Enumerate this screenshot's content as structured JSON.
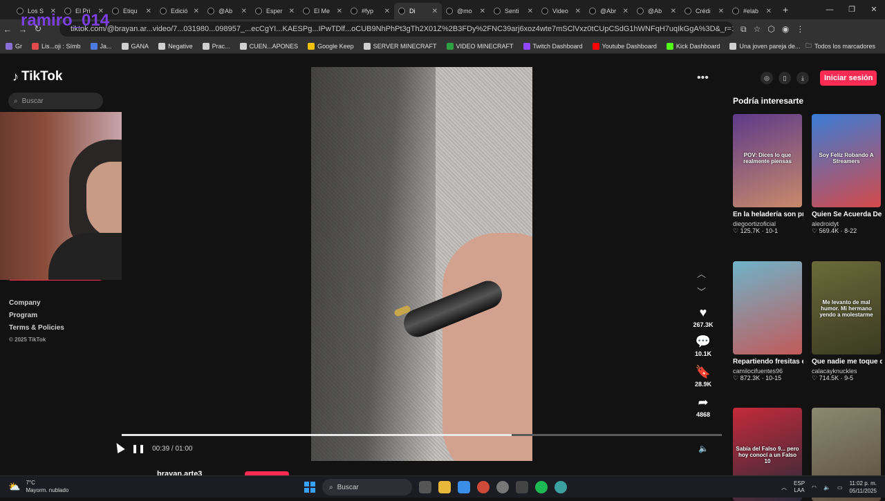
{
  "browser": {
    "tabs": [
      {
        "label": "Los S"
      },
      {
        "label": "El Pri"
      },
      {
        "label": "Etiqu"
      },
      {
        "label": "Edició"
      },
      {
        "label": "@Ab"
      },
      {
        "label": "Esper"
      },
      {
        "label": "El Me"
      },
      {
        "label": "#fyp"
      },
      {
        "label": "Di"
      },
      {
        "label": "@mo"
      },
      {
        "label": "Senti"
      },
      {
        "label": "Video"
      },
      {
        "label": "@Abr"
      },
      {
        "label": "@Ab"
      },
      {
        "label": "Crédi"
      },
      {
        "label": "#elab"
      }
    ],
    "new_tab": "+",
    "url": "tiktok.com/@brayan.ar...video/7...031980...098957_...ecCgYI...KAESPg...IPwTDlf...oCUB9NhPhPt3gTh2X01Z%2B3FDy%2FNC39arj6xoz4wte7mSClVxz0tCUpCSdG1hWNFqH7uqIkGgA%3D&_r=1&_svg=1&check...",
    "bookmarks": [
      {
        "label": "Gr",
        "color": "#8a6fd6"
      },
      {
        "label": "Lis...oji : Símb",
        "color": "#e04a4a"
      },
      {
        "label": "Ja...",
        "color": "#4a7be0"
      },
      {
        "label": "GANA",
        "color": "#d0d0d0"
      },
      {
        "label": "Negative",
        "color": "#d0d0d0"
      },
      {
        "label": "Prac...",
        "color": "#d0d0d0"
      },
      {
        "label": "CUEN...APONES",
        "color": "#d0d0d0"
      },
      {
        "label": "Google Keep",
        "color": "#f4c20d"
      },
      {
        "label": "SERVER MINECRAFT",
        "color": "#d0d0d0"
      },
      {
        "label": "VIDEO MINECRAFT",
        "color": "#2ea043"
      },
      {
        "label": "Twitch Dashboard",
        "color": "#9146ff"
      },
      {
        "label": "Youtube Dashboard",
        "color": "#ff0000"
      },
      {
        "label": "Kick Dashboard",
        "color": "#53fc18"
      },
      {
        "label": "Una joven pareja de...",
        "color": "#d0d0d0"
      }
    ],
    "all_bookmarks": "Todos los marcadores"
  },
  "overlay": {
    "streamer_name": "ramiro_014"
  },
  "sidebar": {
    "logo": "TikTok",
    "search_placeholder": "Buscar",
    "links": [
      "Company",
      "Program",
      "Terms & Policies"
    ],
    "copyright": "© 2025 TikTok"
  },
  "video": {
    "likes": "267.3K",
    "comments": "10.1K",
    "saves": "28.9K",
    "shares": "4868",
    "time": "00:39 / 01:00",
    "progress": 0.65,
    "author": "brayan.arte3"
  },
  "header": {
    "login_label": "Iniciar sesión"
  },
  "suggestions": {
    "title": "Podría interesarte",
    "items": [
      {
        "title": "En la heladería son primero los modale...",
        "author": "diegoortizoficial",
        "likes": "125.7K",
        "date": "10-1",
        "thumb_text": "POV: Dices lo que realmente piensas",
        "thumb_colors": [
          "#5e3a8a",
          "#c98a6a"
        ]
      },
      {
        "title": "Quien Se Acuerda De Esto? 😍 💜 #Roblo...",
        "author": "aledroidyt",
        "likes": "569.4K",
        "date": "8-22",
        "thumb_text": "Soy Feliz Robando A Streamers",
        "thumb_colors": [
          "#3a7bd5",
          "#d44a4a"
        ]
      },
      {
        "title": "Repartiendo fresitas en la calle 🍓 📍 ...",
        "author": "camilocifuentes96",
        "likes": "872.3K",
        "date": "10-15",
        "thumb_text": "",
        "thumb_colors": [
          "#6fb3c9",
          "#c25a5a"
        ]
      },
      {
        "title": "Que nadie me toque que estoy de malas...",
        "author": "calacayknuckles",
        "likes": "714.5K",
        "date": "9-5",
        "thumb_text": "Me levanto de mal humor. Mi hermano yendo a molestarme",
        "thumb_colors": [
          "#6b6b3a",
          "#3a3a22"
        ]
      },
      {
        "title": "",
        "author": "",
        "likes": "",
        "date": "",
        "thumb_text": "Sabía del Falso 9... pero hoy conocí a un Falso 10",
        "thumb_colors": [
          "#c42a3a",
          "#2a2a3a"
        ]
      },
      {
        "title": "",
        "author": "",
        "likes": "",
        "date": "",
        "thumb_text": "",
        "thumb_colors": [
          "#8a8a70",
          "#5a4a3a"
        ]
      }
    ]
  },
  "taskbar": {
    "temp": "7°C",
    "weather": "Mayorm. nublado",
    "search_placeholder": "Buscar",
    "lang_top": "ESP",
    "lang_bottom": "LAA",
    "time": "11:02 p. m.",
    "date": "05/11/2025"
  }
}
